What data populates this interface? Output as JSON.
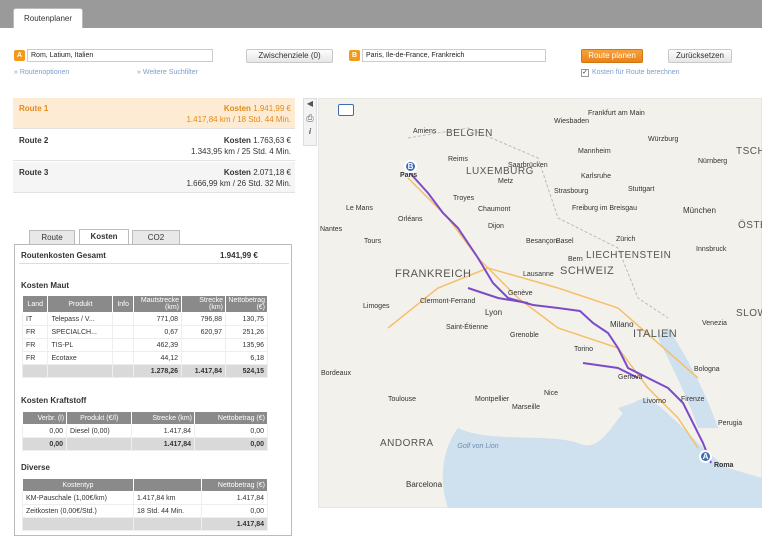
{
  "tab": {
    "label": "Routenplaner"
  },
  "form": {
    "start_badge": "A",
    "start_value": "Rom, Latium, Italien",
    "via_label": "Zwischenziele (0)",
    "end_badge": "B",
    "end_value": "Paris, Ile-de-France, Frankreich",
    "plan_label": "Route planen",
    "reset_label": "Zurücksetzen",
    "route_options": "» Routenoptionen",
    "more_filters": "» Weitere Suchfilter",
    "costs_checkbox": "Kosten für Route berechnen"
  },
  "routes": [
    {
      "name": "Route 1",
      "cost_label": "Kosten",
      "cost": "1.941,99 €",
      "detail": "1.417,84 km / 18 Std. 44 Min."
    },
    {
      "name": "Route 2",
      "cost_label": "Kosten",
      "cost": "1.763,63 €",
      "detail": "1.343,95 km / 25 Std. 4 Min."
    },
    {
      "name": "Route 3",
      "cost_label": "Kosten",
      "cost": "2.071,18 €",
      "detail": "1.666,99 km / 26 Std. 32 Min."
    }
  ],
  "panel_tabs": [
    "Route",
    "Kosten",
    "CO2"
  ],
  "costs": {
    "total_label": "Routenkosten Gesamt",
    "total_value": "1.941,99 €",
    "toll_title": "Kosten Maut",
    "toll_headers": [
      "Land",
      "Produkt",
      "Info",
      "Mautstrecke (km)",
      "Strecke (km)",
      "Nettobetrag (€)"
    ],
    "toll_rows": [
      [
        "IT",
        "Telepass / V...",
        "",
        "771,08",
        "796,88",
        "130,75"
      ],
      [
        "FR",
        "SPECIALCH...",
        "",
        "0,67",
        "620,97",
        "251,26"
      ],
      [
        "FR",
        "TIS-PL",
        "",
        "462,39",
        "",
        "135,96"
      ],
      [
        "FR",
        "Ecotaxe",
        "",
        "44,12",
        "",
        "6,18"
      ]
    ],
    "toll_sum": [
      "",
      "",
      "",
      "1.278,26",
      "1.417,84",
      "524,15"
    ],
    "fuel_title": "Kosten Kraftstoff",
    "fuel_headers": [
      "Verbr. (l)",
      "Produkt (€/l)",
      "Strecke (km)",
      "Nettobetrag (€)"
    ],
    "fuel_rows": [
      [
        "0,00",
        "Diesel (0,00)",
        "1.417,84",
        "0,00"
      ]
    ],
    "fuel_sum": [
      "0,00",
      "",
      "1.417,84",
      "0,00"
    ],
    "misc_title": "Diverse",
    "misc_headers": [
      "Kostentyp",
      "",
      "Nettobetrag (€)"
    ],
    "misc_rows": [
      [
        "KM-Pauschale (1,00€/km)",
        "1.417,84 km",
        "1.417,84"
      ],
      [
        "Zeitkosten (0,00€/Std.)",
        "18 Std. 44 Min.",
        "0,00"
      ]
    ],
    "misc_sum": [
      "",
      "",
      "1.417,84"
    ]
  },
  "map": {
    "countries": [
      "BELGIEN",
      "LUXEMBURG",
      "FRANKREICH",
      "SCHWEIZ",
      "LIECHTENSTEIN",
      "ITALIEN",
      "ANDORRA",
      "TSCHE",
      "ÖSTE",
      "SLOW"
    ],
    "cities": [
      "Amiens",
      "Frankfurt am Main",
      "Wiesbaden",
      "Mannheim",
      "Würzburg",
      "Saarbrücken",
      "Nürnberg",
      "Stuttgart",
      "Paris",
      "Reims",
      "Metz",
      "Strasbourg",
      "Karlsruhe",
      "Orléans",
      "Troyes",
      "Freiburg im Breisgau",
      "München",
      "Le Mans",
      "Chaumont",
      "Dijon",
      "Tours",
      "Besançon",
      "Basel",
      "Zürich",
      "Innsbruck",
      "Lausanne",
      "Genève",
      "Bern",
      "Lyon",
      "Clermont-Ferrand",
      "Limoges",
      "Saint-Étienne",
      "Grenoble",
      "Milano",
      "Venezia",
      "Torino",
      "Genova",
      "Bologna",
      "Firenze",
      "Livorno",
      "Bordeaux",
      "Toulouse",
      "Montpellier",
      "Marseille",
      "Nice",
      "Perugia",
      "Barcelona",
      "Roma",
      "Nantes"
    ],
    "sea_label": "Golf von Lion",
    "marker_start": "A",
    "marker_end": "B"
  },
  "colors": {
    "accent": "#f39a1b",
    "route": "#7d4bc9",
    "selected_bg": "#fdebd3"
  }
}
